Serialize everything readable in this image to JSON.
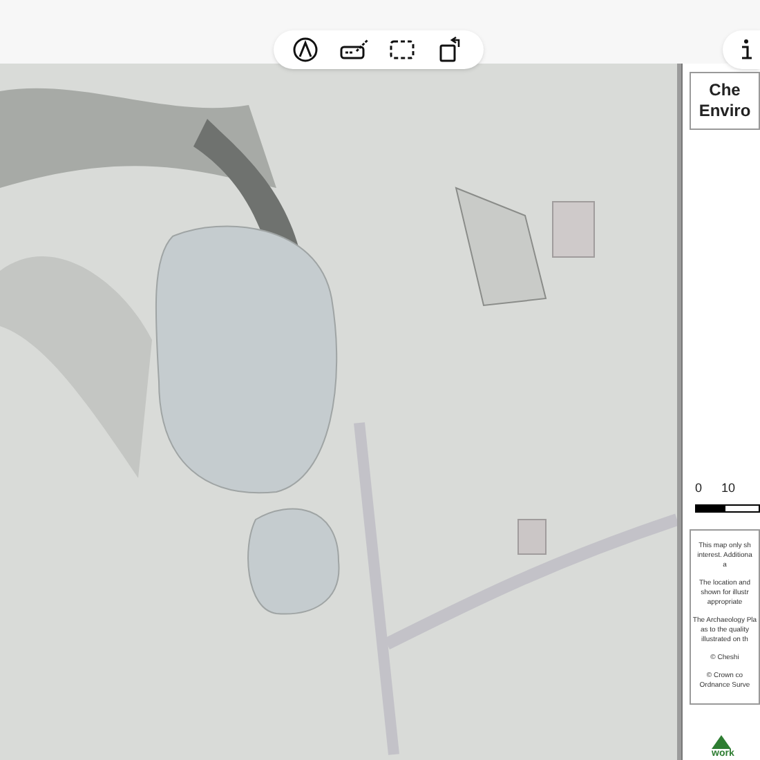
{
  "toolbar": {
    "tools": [
      {
        "kind": "markup"
      },
      {
        "kind": "signature"
      },
      {
        "kind": "select"
      },
      {
        "kind": "rotate"
      }
    ]
  },
  "legend": {
    "title_lines": [
      "Che",
      "Enviro"
    ],
    "scale": {
      "labels": [
        "0",
        "10"
      ]
    },
    "notes": [
      "This map only sh",
      "interest. Additiona",
      "a",
      "The location and",
      "shown for illustr",
      "appropriate",
      "The Archaeology Pla",
      "as to the quality",
      "illustrated on th",
      "© Cheshi",
      "© Crown co",
      "Ordnance Surve"
    ],
    "logo_text": "work"
  }
}
